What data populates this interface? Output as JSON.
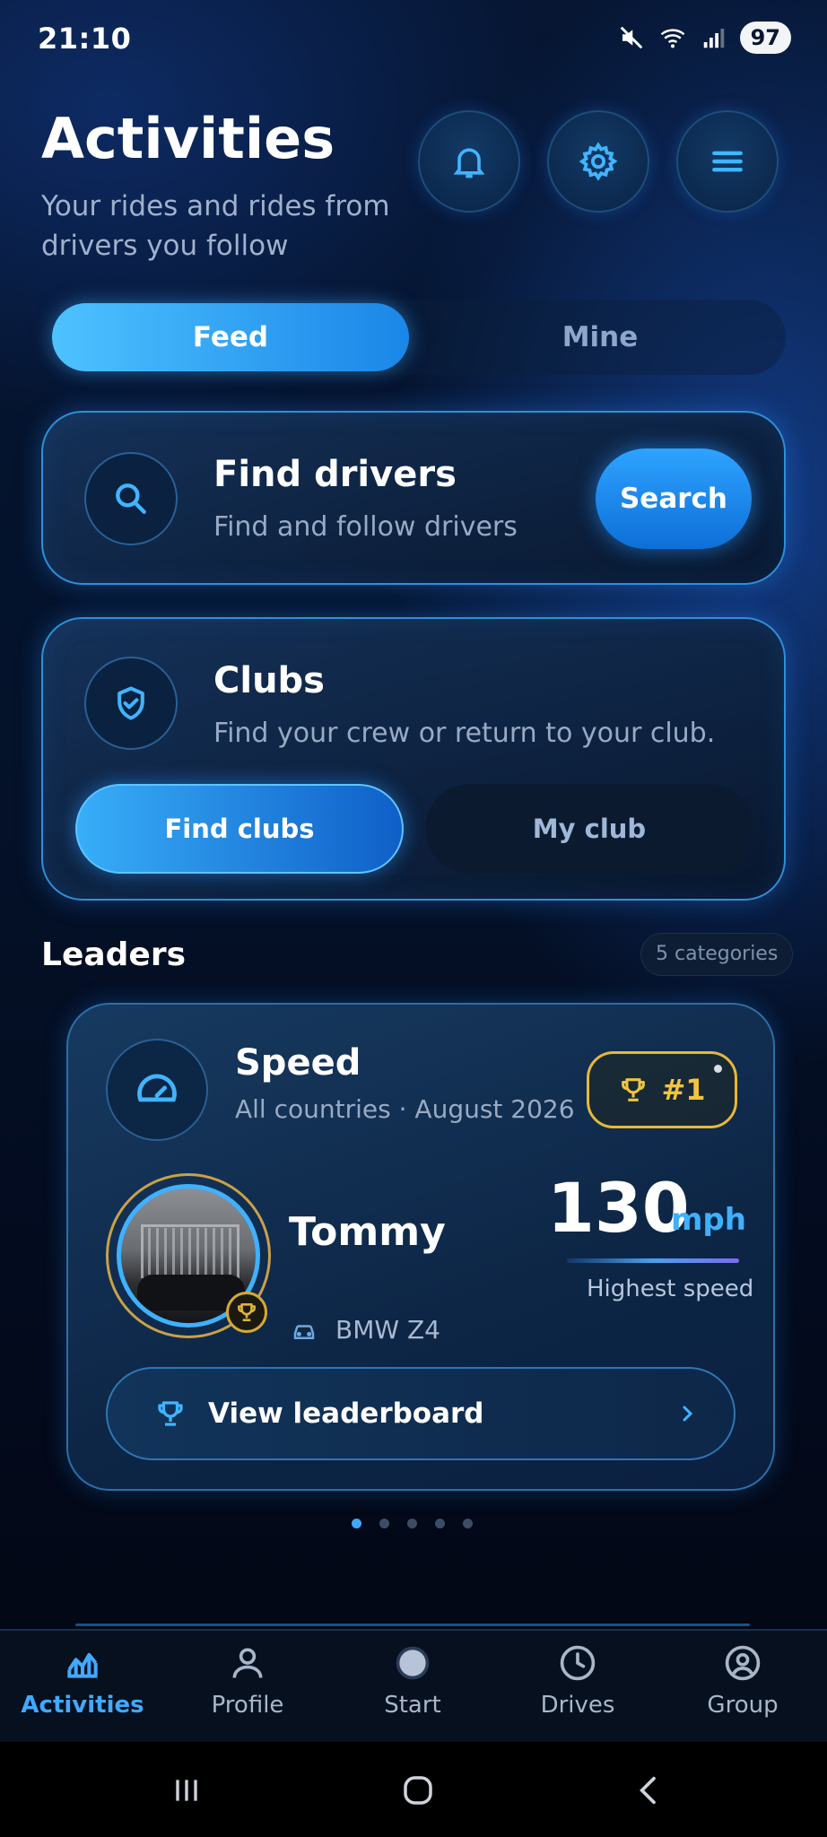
{
  "status": {
    "time": "21:10",
    "battery": "97"
  },
  "header": {
    "title": "Activities",
    "subtitle": "Your rides and rides from drivers you follow",
    "icons": [
      "bell-icon",
      "gear-icon",
      "menu-icon"
    ]
  },
  "tabs": {
    "feed": "Feed",
    "mine": "Mine",
    "active": "Feed"
  },
  "find_drivers": {
    "title": "Find drivers",
    "subtitle": "Find and follow drivers",
    "button": "Search",
    "icon": "search-icon"
  },
  "clubs": {
    "title": "Clubs",
    "subtitle": "Find your crew or return to your club.",
    "find_button": "Find clubs",
    "my_button": "My club",
    "icon": "shield-check-icon"
  },
  "leaders": {
    "title": "Leaders",
    "categories_badge": "5 categories",
    "card": {
      "category": "Speed",
      "scope": "All countries · August 2026",
      "rank": "#1",
      "driver": "Tommy",
      "car": "BMW Z4",
      "value": "130",
      "unit": "mph",
      "metric_label": "Highest speed",
      "button": "View leaderboard"
    },
    "pages": 5,
    "active_page": 1
  },
  "nav": {
    "items": [
      {
        "label": "Activities",
        "icon": "chart-icon",
        "active": true
      },
      {
        "label": "Profile",
        "icon": "person-icon",
        "active": false
      },
      {
        "label": "Start",
        "icon": "record-dot-icon",
        "active": false
      },
      {
        "label": "Drives",
        "icon": "clock-icon",
        "active": false
      },
      {
        "label": "Group",
        "icon": "group-icon",
        "active": false
      }
    ]
  },
  "colors": {
    "accent": "#3fa9ff",
    "gold": "#e6b83a",
    "background": "#04122a"
  }
}
